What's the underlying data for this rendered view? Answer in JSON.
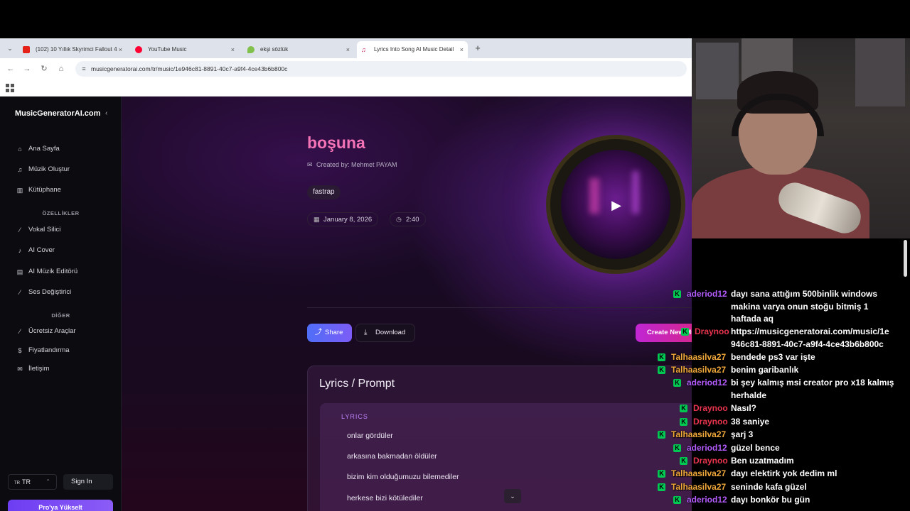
{
  "browser": {
    "tabs": [
      {
        "label": "(102) 10 Yıllık Skyrimci Fallout 4",
        "close": "×"
      },
      {
        "label": "YouTube Music",
        "close": "×"
      },
      {
        "label": "ekşi sözlük",
        "close": "×"
      },
      {
        "label": "Lyrics Into Song AI Music Detail",
        "close": "×"
      }
    ],
    "new_tab": "+",
    "url": "musicgeneratorai.com/tr/music/1e946c81-8891-40c7-a9f4-4ce43b6b800c",
    "url_icon": "tune-icon"
  },
  "sidebar": {
    "brand": "MusicGeneratorAI.com",
    "collapse": "‹",
    "items_main": [
      {
        "label": "Ana Sayfa",
        "icon": "home-icon",
        "glyph": "⌂"
      },
      {
        "label": "Müzik Oluştur",
        "icon": "music-note-icon",
        "glyph": "♫"
      },
      {
        "label": "Kütüphane",
        "icon": "library-icon",
        "glyph": "▥"
      }
    ],
    "section_features": "ÖZELLİKLER",
    "items_features": [
      {
        "label": "Vokal Silici",
        "icon": "wand-icon",
        "glyph": "⁄"
      },
      {
        "label": "AI Cover",
        "icon": "mic-icon",
        "glyph": "♪"
      },
      {
        "label": "AI Müzik Editörü",
        "icon": "editor-icon",
        "glyph": "▤"
      },
      {
        "label": "Ses Değiştirici",
        "icon": "wand-icon",
        "glyph": "⁄"
      }
    ],
    "section_other": "DİĞER",
    "items_other": [
      {
        "label": "Ücretsiz Araçlar",
        "icon": "tools-icon",
        "glyph": "⁄"
      },
      {
        "label": "Fiyatlandırma",
        "icon": "dollar-icon",
        "glyph": "$"
      },
      {
        "label": "İletişim",
        "icon": "mail-icon",
        "glyph": "✉"
      }
    ],
    "lang_flag": "TR",
    "lang": "TR",
    "lang_arrow": "⌃",
    "signin": "Sign In",
    "upgrade": "Pro'ya Yükselt"
  },
  "song": {
    "title": "boşuna",
    "created_by": "Created by: Mehmet PAYAM",
    "tag": "fastrap",
    "date": "January 8, 2026",
    "duration": "2:40",
    "play_icon": "play-icon"
  },
  "actions": {
    "share": "Share",
    "download": "Download",
    "create": "Create New Music"
  },
  "lyrics": {
    "heading": "Lyrics / Prompt",
    "label": "LYRICS",
    "lines": [
      "onlar gördüler",
      "arkasına bakmadan öldüler",
      "bizim kim olduğumuzu bilemediler",
      "herkese bizi kötülediler"
    ]
  },
  "chat": {
    "messages": [
      {
        "user": "aderiod12",
        "color": "#b45cff",
        "text": "dayı sana attığım 500binlik windows"
      },
      {
        "user": "",
        "color": "#b45cff",
        "text": "makina varya onun stoğu bitmiş 1"
      },
      {
        "user": "",
        "color": "#b45cff",
        "text": "haftada aq"
      },
      {
        "user": "Draynoo",
        "color": "#e8344e",
        "text": "https://musicgeneratorai.com/music/1e"
      },
      {
        "user": "",
        "color": "#e8344e",
        "text": "946c81-8891-40c7-a9f4-4ce43b6b800c"
      },
      {
        "user": "Talhaasilva27",
        "color": "#f2a93b",
        "text": "bendede ps3 var işte"
      },
      {
        "user": "Talhaasilva27",
        "color": "#f2a93b",
        "text": "benim garibanlık"
      },
      {
        "user": "aderiod12",
        "color": "#b45cff",
        "text": "bi şey kalmış msi creator pro x18 kalmış"
      },
      {
        "user": "",
        "color": "#b45cff",
        "text": "herhalde"
      },
      {
        "user": "Draynoo",
        "color": "#e8344e",
        "text": "Nasıl?"
      },
      {
        "user": "Draynoo",
        "color": "#e8344e",
        "text": "38 saniye"
      },
      {
        "user": "Talhaasilva27",
        "color": "#f2a93b",
        "text": "şarj 3"
      },
      {
        "user": "aderiod12",
        "color": "#b45cff",
        "text": "güzel bence"
      },
      {
        "user": "Draynoo",
        "color": "#e8344e",
        "text": "Ben uzatmadım"
      },
      {
        "user": "Talhaasilva27",
        "color": "#f2a93b",
        "text": "dayı elektirk yok dedim ml"
      },
      {
        "user": "Talhaasilva27",
        "color": "#f2a93b",
        "text": "seninde kafa güzel"
      },
      {
        "user": "aderiod12",
        "color": "#b45cff",
        "text": "dayı bonkör bu gün"
      }
    ]
  }
}
